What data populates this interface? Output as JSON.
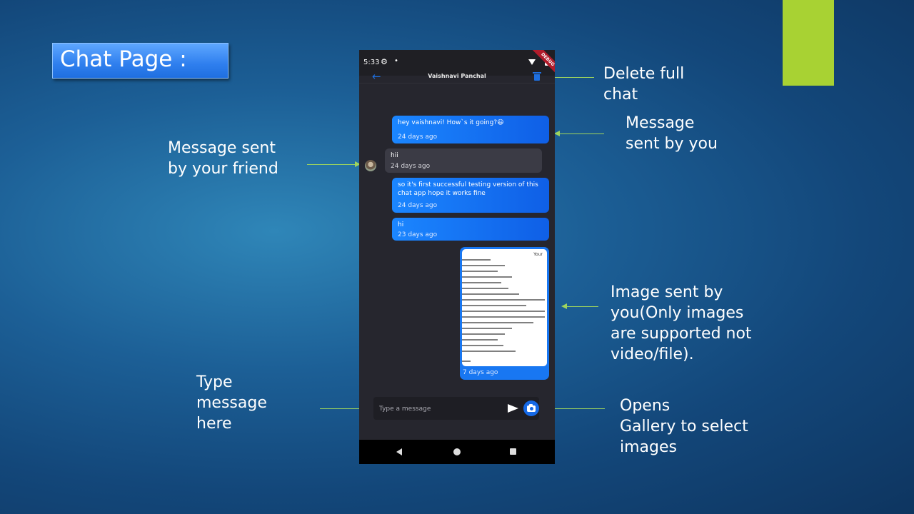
{
  "slide": {
    "title": "Chat Page :",
    "annotations": {
      "delete_chat": "Delete full\nchat",
      "message_sent": "Message\nsent by you",
      "friend_message": "Message sent\nby your friend",
      "image_sent": "Image sent by\nyou(Only images\nare supported not\nvideo/file).",
      "type_message": "Type\nmessage\nhere",
      "open_gallery": "Opens\nGallery to select\nimages"
    },
    "colors": {
      "accent_green": "#a8d233",
      "title_box": "#2f7fee",
      "arrow": "#9ed45e"
    }
  },
  "phone": {
    "status_bar": {
      "time": "5:33",
      "debug_banner": "DEBUG"
    },
    "app_bar": {
      "title": "Vaishnavi Panchal",
      "back_icon": "arrow-left-icon",
      "delete_icon": "trash-icon"
    },
    "messages": [
      {
        "sender": "me",
        "text": "hey vaishnavi! How`s it going?😃",
        "time": "24 days ago"
      },
      {
        "sender": "friend",
        "text": "hii",
        "time": "24 days ago"
      },
      {
        "sender": "me",
        "text": "so it's first successful testing version of this chat app hope it works fine",
        "time": "24 days ago"
      },
      {
        "sender": "me",
        "text": "hi",
        "time": "23 days ago"
      },
      {
        "sender": "me",
        "type": "image",
        "image_caption": "Your",
        "time": "7 days ago"
      }
    ],
    "input": {
      "placeholder": "Type a message",
      "send_icon": "send-icon",
      "camera_icon": "camera-icon"
    },
    "colors": {
      "sent_bubble": "#1877f2",
      "received_bubble": "#3b3b45",
      "background": "#26262e"
    }
  }
}
